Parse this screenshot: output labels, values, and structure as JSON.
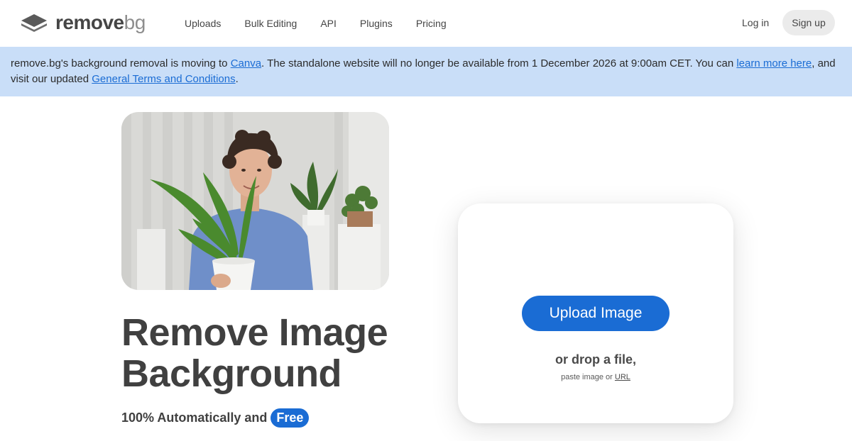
{
  "brand": {
    "name_main": "remove",
    "name_suffix": "bg"
  },
  "nav": {
    "links": [
      "Uploads",
      "Bulk Editing",
      "API",
      "Plugins",
      "Pricing"
    ],
    "login_label": "Log in",
    "signup_label": "Sign up"
  },
  "banner": {
    "part1": "remove.bg's background removal is moving to ",
    "canva_link": "Canva",
    "part2": ". The standalone website will no longer be available from 1 December 2026 at 9:00am CET. You can ",
    "learn_link": "learn more here",
    "part3": ", and visit our updated ",
    "terms_link": "General Terms and Conditions",
    "part4": "."
  },
  "hero": {
    "headline_line1": "Remove Image",
    "headline_line2": "Background",
    "subline": "100% Automatically and",
    "free_badge": "Free"
  },
  "upload": {
    "button_label": "Upload Image",
    "drop_text": "or drop a file,",
    "paste_prefix": "paste image or ",
    "url_link": "URL"
  },
  "colors": {
    "accent": "#1a6cd4",
    "banner_bg": "#c9def8",
    "text_dark": "#404040"
  }
}
